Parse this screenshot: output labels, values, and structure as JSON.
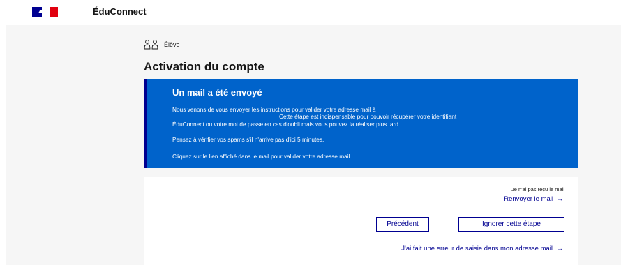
{
  "header": {
    "brand": "ÉduConnect"
  },
  "profile": {
    "role_label": "Élève",
    "icon": "students-icon"
  },
  "page": {
    "title": "Activation du compte"
  },
  "alert": {
    "title": "Un mail a été envoyé",
    "line1": "Nous venons de vous envoyer les instructions pour valider votre adresse mail à",
    "line2": "Cette étape est indispensable pour pouvoir récupérer votre identifiant",
    "line3": "ÉduConnect ou votre mot de passe en cas d'oubli mais vous pouvez la réaliser plus tard.",
    "line4": "Pensez à vérifier vos spams s'il n'arrive pas d'ici 5 minutes.",
    "line5": "Cliquez sur le lien affiché dans le mail pour valider votre adresse mail.",
    "background_color": "#0063cb"
  },
  "actions": {
    "not_received": "Je n'ai pas reçu le mail",
    "resend_label": "Renvoyer le mail",
    "previous_label": "Précédent",
    "skip_label": "Ignorer cette étape",
    "error_label": "J'ai fait une erreur de saisie dans mon adresse mail",
    "arrow": "→"
  },
  "colors": {
    "accent": "#000091",
    "flag_red": "#e1000f"
  }
}
